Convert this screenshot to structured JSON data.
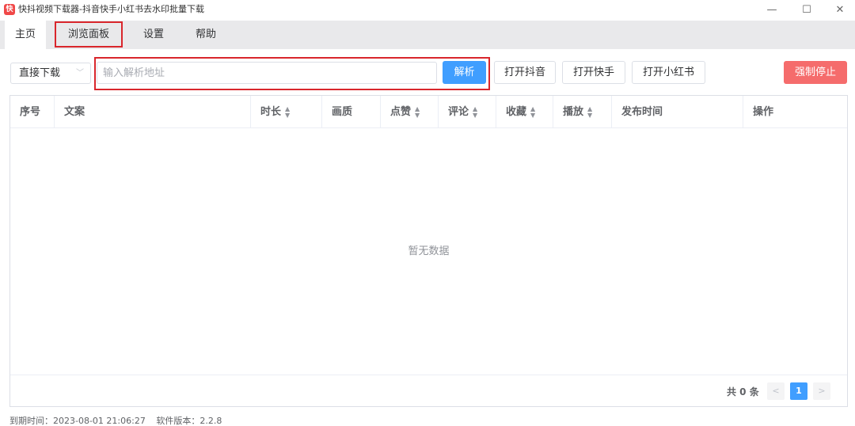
{
  "window": {
    "icon_text": "快",
    "title": "快抖视频下载器-抖音快手小红书去水印批量下载",
    "minimize": "—",
    "maximize": "☐",
    "close": "✕"
  },
  "menu": {
    "home": "主页",
    "browse_panel": "浏览面板",
    "settings": "设置",
    "help": "帮助"
  },
  "toolbar": {
    "mode_selected": "直接下载",
    "url_placeholder": "输入解析地址",
    "parse_label": "解析",
    "open_douyin": "打开抖音",
    "open_kuaishou": "打开快手",
    "open_xhs": "打开小红书",
    "force_stop": "强制停止"
  },
  "table": {
    "columns": [
      "序号",
      "文案",
      "时长",
      "画质",
      "点赞",
      "评论",
      "收藏",
      "播放",
      "发布时间",
      "操作"
    ],
    "sortable": [
      false,
      false,
      true,
      false,
      true,
      true,
      true,
      true,
      false,
      false
    ],
    "empty_text": "暂无数据"
  },
  "pagination": {
    "total_label": "共 0 条",
    "current_page": "1",
    "prev": "<",
    "next": ">"
  },
  "footer": {
    "expiry": "到期时间：2023-08-01 21:06:27",
    "version": "软件版本：2.2.8"
  },
  "colors": {
    "primary": "#409eff",
    "danger": "#f56c6c",
    "highlight_box": "#d9262c"
  }
}
